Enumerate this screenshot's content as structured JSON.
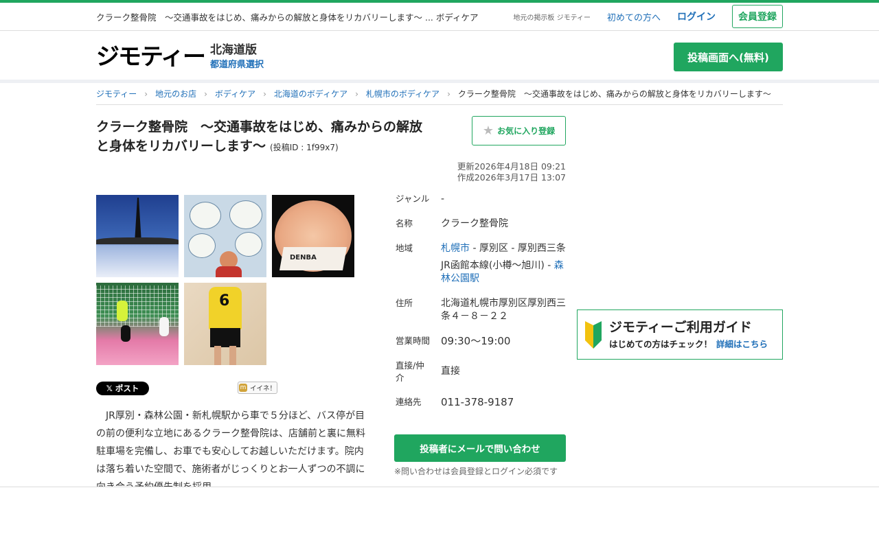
{
  "topbar": {
    "page_title": "クラーク整骨院　〜交通事故をはじめ、痛みからの解放と身体をリカバリーします〜 ... ボディケア",
    "site_label": "地元の掲示板 ジモティー",
    "first_time_label": "初めての方へ",
    "login_label": "ログイン",
    "register_label": "会員登録"
  },
  "header": {
    "logo": "ジモティー",
    "region_name": "北海道版",
    "region_select_label": "都道府県選択",
    "post_button_label": "投稿画面へ(無料)"
  },
  "breadcrumb": {
    "items": [
      "ジモティー",
      "地元のお店",
      "ボディケア",
      "北海道のボディケア",
      "札幌市のボディケア"
    ],
    "separator": "›",
    "current": "クラーク整骨院　〜交通事故をはじめ、痛みからの解放と身体をリカバリーします〜"
  },
  "listing": {
    "title": "クラーク整骨院　〜交通事故をはじめ、痛みからの解放と身体をリカバリーします〜",
    "post_id": "(投稿ID : 1f99x7)",
    "favorite_label": "お気に入り登録",
    "updated": "更新2026年4月18日 09:21",
    "created": "作成2026年3月17日 13:07",
    "gallery_brand_text": "DENBA",
    "gallery_jersey_number": "6",
    "share_x_label": "𝕏 ポスト",
    "share_mixi_label": "イイネ！",
    "description": "　JR厚別・森林公園・新札幌駅から車で５分ほど、バス停が目の前の便利な立地にあるクラーク整骨院は、店舗前と裏に無料駐車場を完備し、お車でも安心してお越しいただけます。院内は落ち着いた空間で、施術者がじっくりとお一人ずつの不調に向き合う予約優先制を採用。",
    "details": {
      "genre_label": "ジャンル",
      "genre_value": "-",
      "name_label": "名称",
      "name_value": "クラーク整骨院",
      "area_label": "地域",
      "area_city": "札幌市",
      "area_rest": " - 厚別区 - 厚別西三条",
      "area_line": "JR函館本線(小樽〜旭川) - ",
      "area_station": "森林公園駅",
      "address_label": "住所",
      "address_value": "北海道札幌市厚別区厚別西三条４－８－２２",
      "hours_label": "営業時間",
      "hours_value": "09:30〜19:00",
      "direct_label": "直接/仲介",
      "direct_value": "直接",
      "contact_label": "連絡先",
      "contact_value": "011-378-9187"
    },
    "contact_button_label": "投稿者にメールで問い合わせ",
    "contact_note": "※問い合わせは会員登録とログイン必須です"
  },
  "guide": {
    "title": "ジモティーご利用ガイド",
    "subtitle": "はじめての方はチェック！",
    "link_label": "詳細はこちら"
  },
  "colors": {
    "brand_green": "#20a65f",
    "link_blue": "#1f6fb8"
  }
}
